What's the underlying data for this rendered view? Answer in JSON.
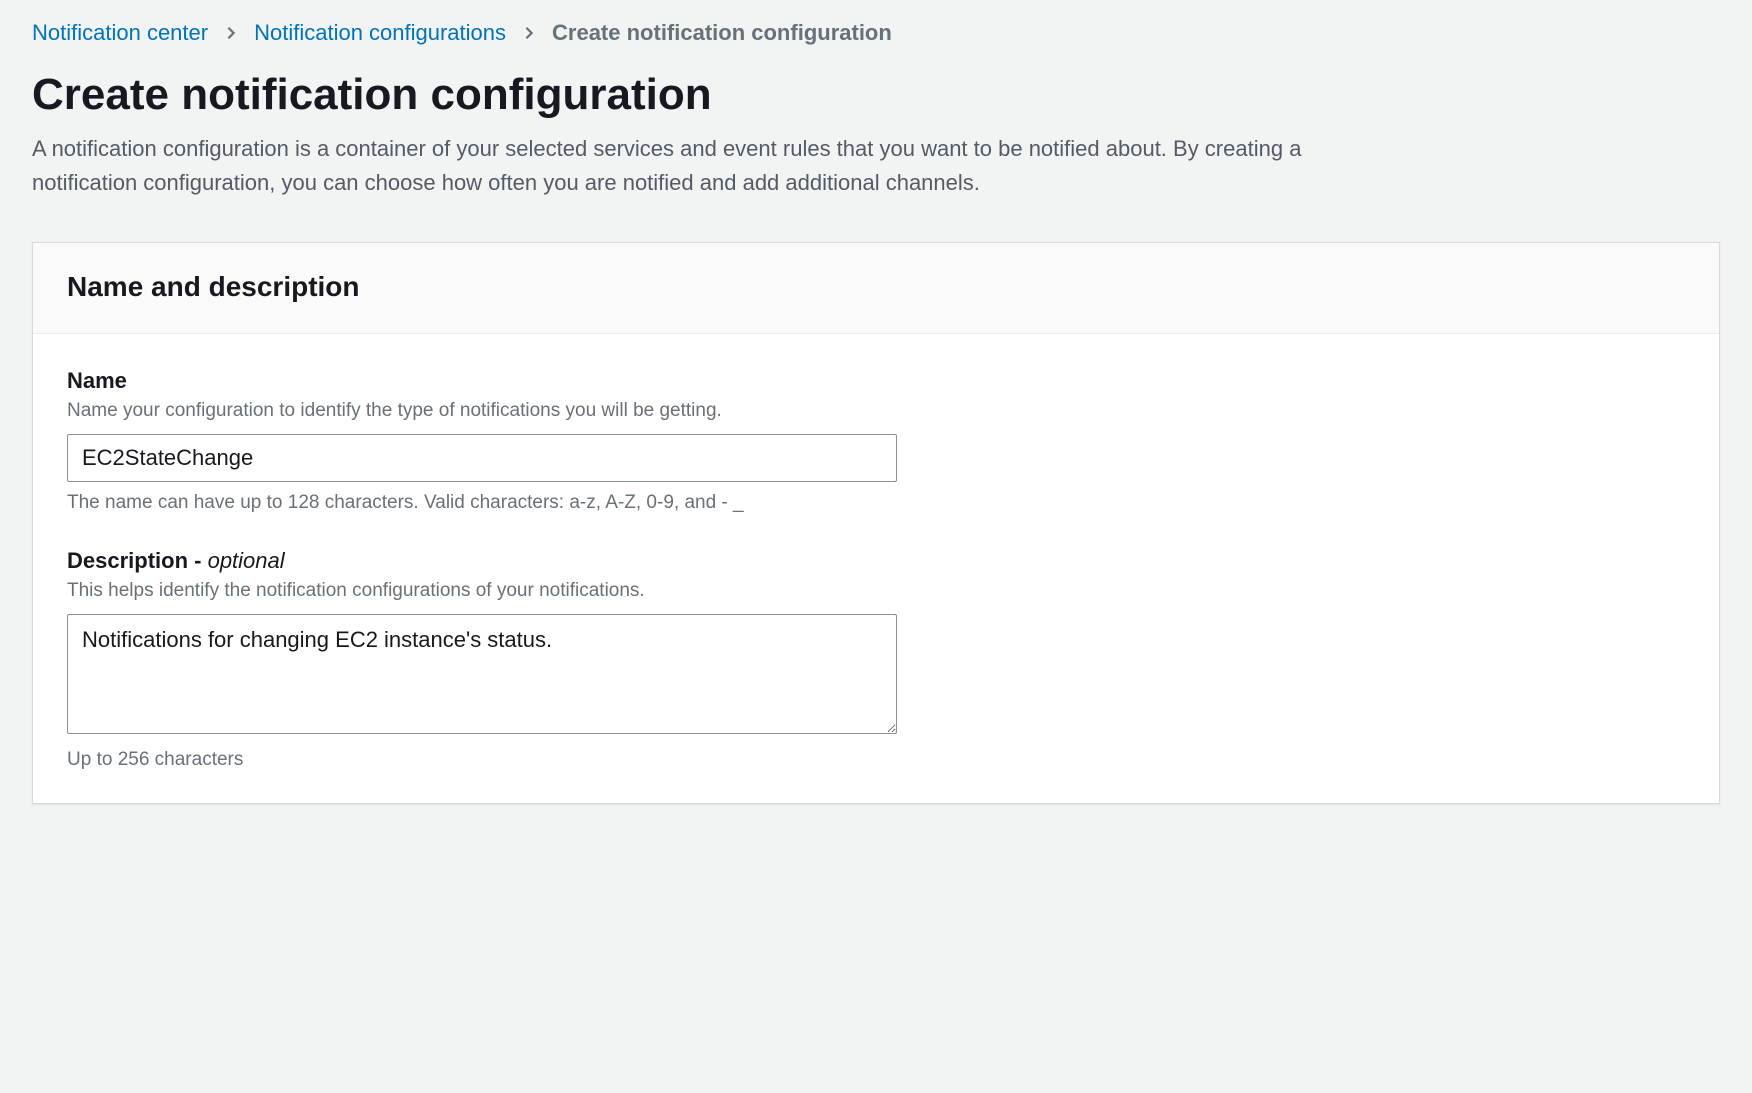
{
  "breadcrumb": {
    "items": [
      {
        "label": "Notification center",
        "link": true
      },
      {
        "label": "Notification configurations",
        "link": true
      },
      {
        "label": "Create notification configuration",
        "link": false
      }
    ]
  },
  "page": {
    "title": "Create notification configuration",
    "description": "A notification configuration is a container of your selected services and event rules that you want to be notified about. By creating a notification configuration, you can choose how often you are notified and add additional channels."
  },
  "panel": {
    "title": "Name and description",
    "name_field": {
      "label": "Name",
      "hint": "Name your configuration to identify the type of notifications you will be getting.",
      "value": "EC2StateChange",
      "constraint": "The name can have up to 128 characters. Valid characters: a-z, A-Z, 0-9, and - _"
    },
    "description_field": {
      "label_main": "Description - ",
      "label_optional": "optional",
      "hint": "This helps identify the notification configurations of your notifications.",
      "value": "Notifications for changing EC2 instance's status.",
      "constraint": "Up to 256 characters"
    }
  }
}
